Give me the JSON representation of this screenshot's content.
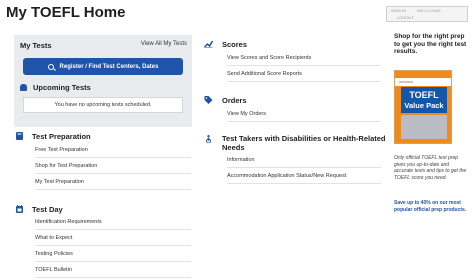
{
  "page": {
    "title": "My TOEFL Home"
  },
  "top_widget": {
    "text_a": "SIGN IN",
    "text_b": "WELCOME",
    "text_c": "LOGOUT"
  },
  "my_tests": {
    "title": "My Tests",
    "view_all": "View All My Tests",
    "register_button": "Register / Find Test Centers, Dates",
    "upcoming_title": "Upcoming Tests",
    "no_tests_text": "You have no upcoming tests scheduled."
  },
  "test_preparation": {
    "title": "Test Preparation",
    "links": [
      "Free Test Preparation",
      "Shop for Test Preparation",
      "My Test Preparation"
    ]
  },
  "test_day": {
    "title": "Test Day",
    "links": [
      "Identification Requirements",
      "What to Expect",
      "Testing Policies",
      "TOEFL Bulletin"
    ]
  },
  "scores": {
    "title": "Scores",
    "links": [
      "View Scores and Score Recipients",
      "Send Additional Score Reports"
    ]
  },
  "orders": {
    "title": "Orders",
    "links": [
      "View My Orders"
    ]
  },
  "disabilities": {
    "title": "Test Takers with Disabilities or Health-Related Needs",
    "links": [
      "Information",
      "Accommodation Application Status/New Request"
    ]
  },
  "promo": {
    "headline": "Shop for the right prep to get you the right test results.",
    "book_title": "TOEFL",
    "book_subtitle": "Value Pack",
    "description": "Only official TOEFL test prep gives you up-to-date and accurate tests and tips to get the TOEFL score you need.",
    "save_text": "Save up to 40% on our most popular official prep products."
  },
  "colors": {
    "accent": "#1f55a8",
    "panel": "#e9ebee",
    "book": "#f08a1c"
  }
}
